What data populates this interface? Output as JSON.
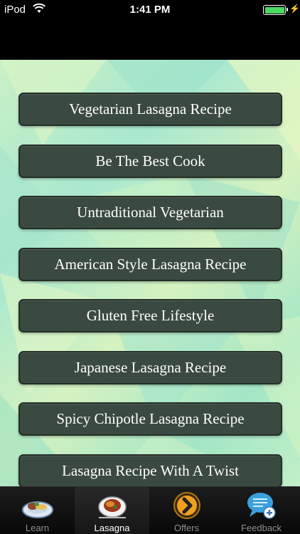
{
  "status": {
    "carrier": "iPod",
    "time": "1:41 PM",
    "charging_icon": "bolt-icon"
  },
  "recipes": [
    "Vegetarian Lasagna Recipe",
    "Be The Best Cook",
    "Untraditional Vegetarian",
    "American Style Lasagna Recipe",
    "Gluten Free Lifestyle",
    "Japanese Lasagna Recipe",
    "Spicy Chipotle Lasagna Recipe",
    "Lasagna Recipe With A Twist"
  ],
  "tabs": [
    {
      "label": "Learn",
      "icon": "plate-food-icon",
      "active": false
    },
    {
      "label": "Lasagna",
      "icon": "lasagna-plate-icon",
      "active": true
    },
    {
      "label": "Offers",
      "icon": "orange-chevron-icon",
      "active": false
    },
    {
      "label": "Feedback",
      "icon": "speech-bubble-plus-icon",
      "active": false
    }
  ],
  "colors": {
    "button_bg": "#3a4a40",
    "background": "#b8ecc8",
    "battery": "#4cd964",
    "offers_orange": "#f0a01e",
    "feedback_blue": "#3aa0e0"
  }
}
